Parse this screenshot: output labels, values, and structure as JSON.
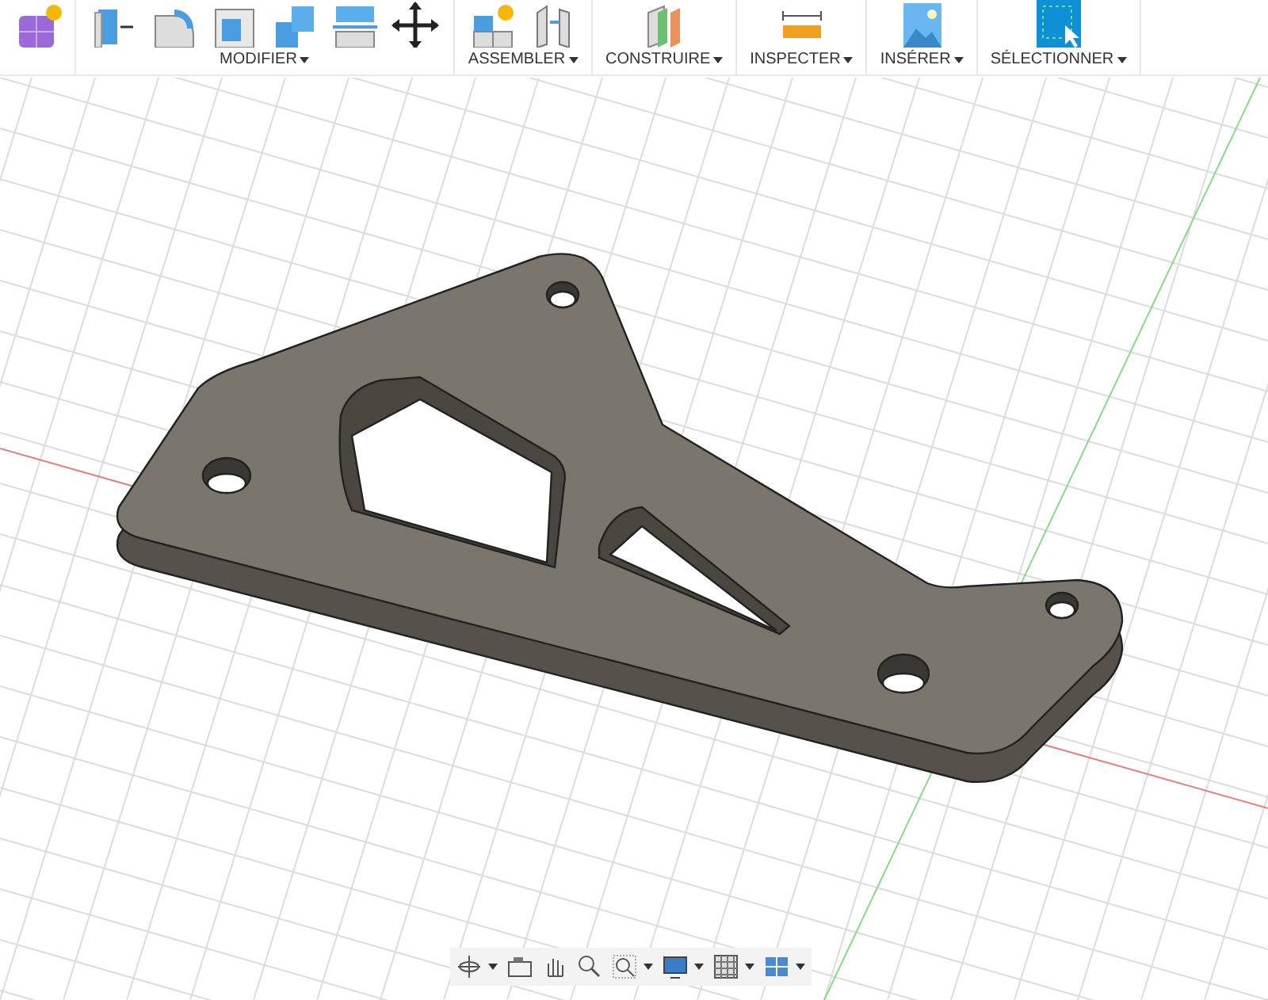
{
  "toolbar": {
    "groups": [
      {
        "icons": [
          {
            "kind": "solid"
          }
        ]
      },
      {
        "label": "MODIFIER",
        "icons": [
          {
            "kind": "pushpull"
          },
          {
            "kind": "fillet"
          },
          {
            "kind": "shell"
          },
          {
            "kind": "combine"
          },
          {
            "kind": "split"
          },
          {
            "kind": "move"
          }
        ]
      },
      {
        "label": "ASSEMBLER",
        "icons": [
          {
            "kind": "newcomp"
          },
          {
            "kind": "joint"
          }
        ]
      },
      {
        "label": "CONSTRUIRE",
        "icons": [
          {
            "kind": "plane"
          }
        ]
      },
      {
        "label": "INSPECTER",
        "icons": [
          {
            "kind": "measure"
          }
        ]
      },
      {
        "label": "INSÉRER",
        "icons": [
          {
            "kind": "image"
          }
        ]
      },
      {
        "label": "SÉLECTIONNER",
        "icons": [
          {
            "kind": "select"
          }
        ]
      }
    ]
  },
  "nav_bar": {
    "tools": [
      {
        "kind": "orbit",
        "menu": true
      },
      {
        "kind": "look",
        "menu": false
      },
      {
        "kind": "pan",
        "menu": false
      },
      {
        "kind": "zoom",
        "menu": false
      },
      {
        "kind": "fit",
        "menu": true
      },
      {
        "kind": "display",
        "menu": true
      },
      {
        "kind": "grid",
        "menu": true
      },
      {
        "kind": "viewports",
        "menu": true
      }
    ]
  }
}
